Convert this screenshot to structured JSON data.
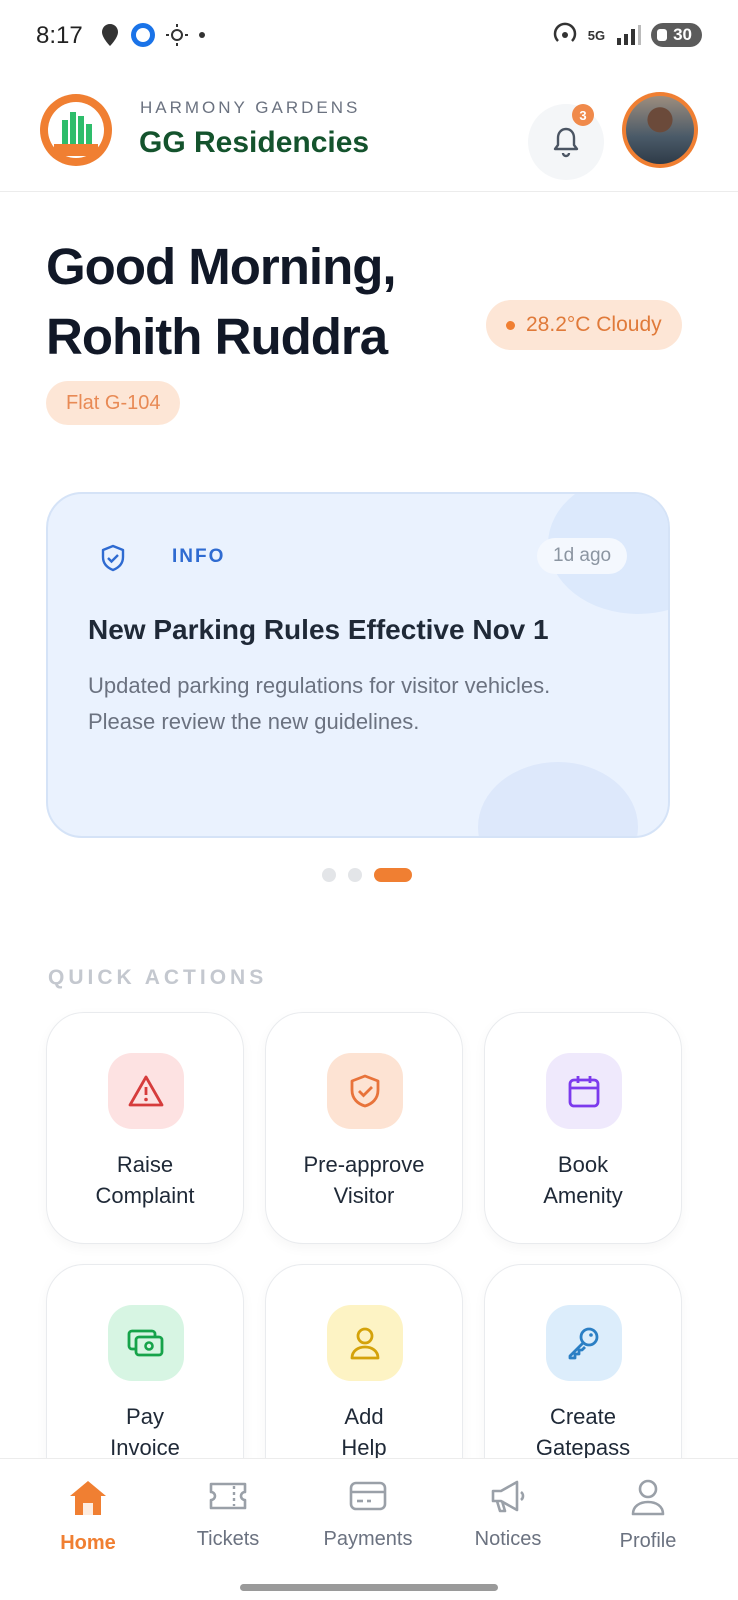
{
  "status_bar": {
    "time": "8:17",
    "network": "5G",
    "battery": "30"
  },
  "header": {
    "brand_subtitle": "HARMONY GARDENS",
    "brand_title": "GG Residencies",
    "notification_count": "3"
  },
  "greeting": {
    "line1": "Good Morning,",
    "line2": "Rohith Ruddra",
    "weather": "28.2°C Cloudy",
    "flat": "Flat G-104"
  },
  "notice": {
    "tag": "INFO",
    "time": "1d ago",
    "title": "New Parking Rules Effective Nov 1",
    "body": "Updated parking regulations for visitor vehicles. Please review the new guidelines.",
    "active_slide": 3,
    "slide_count": 3
  },
  "quick_actions": {
    "title": "QUICK ACTIONS",
    "items": [
      {
        "label_line1": "Raise",
        "label_line2": "Complaint",
        "icon": "warning-icon",
        "bg": "#fde2e2",
        "color": "#d63c3c"
      },
      {
        "label_line1": "Pre-approve",
        "label_line2": "Visitor",
        "icon": "shield-check-icon",
        "bg": "#fde3d3",
        "color": "#e8733a"
      },
      {
        "label_line1": "Book",
        "label_line2": "Amenity",
        "icon": "calendar-icon",
        "bg": "#efe9fc",
        "color": "#7c3aed"
      },
      {
        "label_line1": "Pay",
        "label_line2": "Invoice",
        "icon": "cash-icon",
        "bg": "#d7f5e3",
        "color": "#16a34a"
      },
      {
        "label_line1": "Add",
        "label_line2": "Help",
        "icon": "user-icon",
        "bg": "#fdf3c4",
        "color": "#d4a20a"
      },
      {
        "label_line1": "Create",
        "label_line2": "Gatepass",
        "icon": "key-icon",
        "bg": "#dcedfb",
        "color": "#2b7fc4"
      }
    ]
  },
  "nav": {
    "items": [
      {
        "label": "Home",
        "icon": "home-icon",
        "active": true
      },
      {
        "label": "Tickets",
        "icon": "ticket-icon",
        "active": false
      },
      {
        "label": "Payments",
        "icon": "card-icon",
        "active": false
      },
      {
        "label": "Notices",
        "icon": "megaphone-icon",
        "active": false
      },
      {
        "label": "Profile",
        "icon": "person-icon",
        "active": false
      }
    ]
  },
  "colors": {
    "accent": "#f07f32",
    "brand": "#14532d",
    "info": "#2f6bd1"
  }
}
